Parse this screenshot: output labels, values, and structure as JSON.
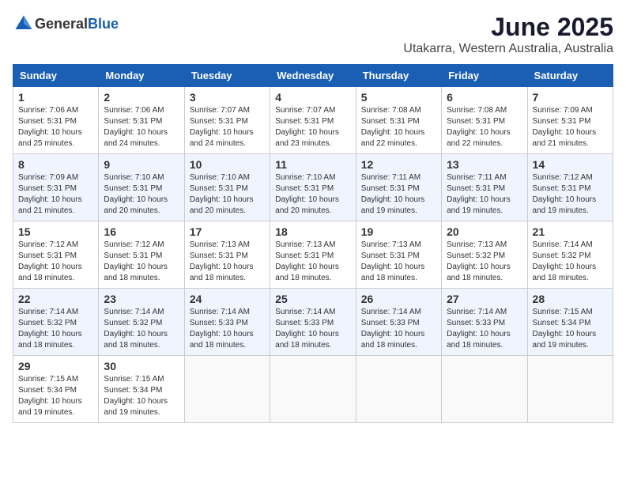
{
  "header": {
    "logo_general": "General",
    "logo_blue": "Blue",
    "month": "June 2025",
    "location": "Utakarra, Western Australia, Australia"
  },
  "weekdays": [
    "Sunday",
    "Monday",
    "Tuesday",
    "Wednesday",
    "Thursday",
    "Friday",
    "Saturday"
  ],
  "weeks": [
    [
      {
        "day": "1",
        "info": "Sunrise: 7:06 AM\nSunset: 5:31 PM\nDaylight: 10 hours\nand 25 minutes."
      },
      {
        "day": "2",
        "info": "Sunrise: 7:06 AM\nSunset: 5:31 PM\nDaylight: 10 hours\nand 24 minutes."
      },
      {
        "day": "3",
        "info": "Sunrise: 7:07 AM\nSunset: 5:31 PM\nDaylight: 10 hours\nand 24 minutes."
      },
      {
        "day": "4",
        "info": "Sunrise: 7:07 AM\nSunset: 5:31 PM\nDaylight: 10 hours\nand 23 minutes."
      },
      {
        "day": "5",
        "info": "Sunrise: 7:08 AM\nSunset: 5:31 PM\nDaylight: 10 hours\nand 22 minutes."
      },
      {
        "day": "6",
        "info": "Sunrise: 7:08 AM\nSunset: 5:31 PM\nDaylight: 10 hours\nand 22 minutes."
      },
      {
        "day": "7",
        "info": "Sunrise: 7:09 AM\nSunset: 5:31 PM\nDaylight: 10 hours\nand 21 minutes."
      }
    ],
    [
      {
        "day": "8",
        "info": "Sunrise: 7:09 AM\nSunset: 5:31 PM\nDaylight: 10 hours\nand 21 minutes."
      },
      {
        "day": "9",
        "info": "Sunrise: 7:10 AM\nSunset: 5:31 PM\nDaylight: 10 hours\nand 20 minutes."
      },
      {
        "day": "10",
        "info": "Sunrise: 7:10 AM\nSunset: 5:31 PM\nDaylight: 10 hours\nand 20 minutes."
      },
      {
        "day": "11",
        "info": "Sunrise: 7:10 AM\nSunset: 5:31 PM\nDaylight: 10 hours\nand 20 minutes."
      },
      {
        "day": "12",
        "info": "Sunrise: 7:11 AM\nSunset: 5:31 PM\nDaylight: 10 hours\nand 19 minutes."
      },
      {
        "day": "13",
        "info": "Sunrise: 7:11 AM\nSunset: 5:31 PM\nDaylight: 10 hours\nand 19 minutes."
      },
      {
        "day": "14",
        "info": "Sunrise: 7:12 AM\nSunset: 5:31 PM\nDaylight: 10 hours\nand 19 minutes."
      }
    ],
    [
      {
        "day": "15",
        "info": "Sunrise: 7:12 AM\nSunset: 5:31 PM\nDaylight: 10 hours\nand 18 minutes."
      },
      {
        "day": "16",
        "info": "Sunrise: 7:12 AM\nSunset: 5:31 PM\nDaylight: 10 hours\nand 18 minutes."
      },
      {
        "day": "17",
        "info": "Sunrise: 7:13 AM\nSunset: 5:31 PM\nDaylight: 10 hours\nand 18 minutes."
      },
      {
        "day": "18",
        "info": "Sunrise: 7:13 AM\nSunset: 5:31 PM\nDaylight: 10 hours\nand 18 minutes."
      },
      {
        "day": "19",
        "info": "Sunrise: 7:13 AM\nSunset: 5:31 PM\nDaylight: 10 hours\nand 18 minutes."
      },
      {
        "day": "20",
        "info": "Sunrise: 7:13 AM\nSunset: 5:32 PM\nDaylight: 10 hours\nand 18 minutes."
      },
      {
        "day": "21",
        "info": "Sunrise: 7:14 AM\nSunset: 5:32 PM\nDaylight: 10 hours\nand 18 minutes."
      }
    ],
    [
      {
        "day": "22",
        "info": "Sunrise: 7:14 AM\nSunset: 5:32 PM\nDaylight: 10 hours\nand 18 minutes."
      },
      {
        "day": "23",
        "info": "Sunrise: 7:14 AM\nSunset: 5:32 PM\nDaylight: 10 hours\nand 18 minutes."
      },
      {
        "day": "24",
        "info": "Sunrise: 7:14 AM\nSunset: 5:33 PM\nDaylight: 10 hours\nand 18 minutes."
      },
      {
        "day": "25",
        "info": "Sunrise: 7:14 AM\nSunset: 5:33 PM\nDaylight: 10 hours\nand 18 minutes."
      },
      {
        "day": "26",
        "info": "Sunrise: 7:14 AM\nSunset: 5:33 PM\nDaylight: 10 hours\nand 18 minutes."
      },
      {
        "day": "27",
        "info": "Sunrise: 7:14 AM\nSunset: 5:33 PM\nDaylight: 10 hours\nand 18 minutes."
      },
      {
        "day": "28",
        "info": "Sunrise: 7:15 AM\nSunset: 5:34 PM\nDaylight: 10 hours\nand 19 minutes."
      }
    ],
    [
      {
        "day": "29",
        "info": "Sunrise: 7:15 AM\nSunset: 5:34 PM\nDaylight: 10 hours\nand 19 minutes."
      },
      {
        "day": "30",
        "info": "Sunrise: 7:15 AM\nSunset: 5:34 PM\nDaylight: 10 hours\nand 19 minutes."
      },
      {
        "day": "",
        "info": ""
      },
      {
        "day": "",
        "info": ""
      },
      {
        "day": "",
        "info": ""
      },
      {
        "day": "",
        "info": ""
      },
      {
        "day": "",
        "info": ""
      }
    ]
  ]
}
